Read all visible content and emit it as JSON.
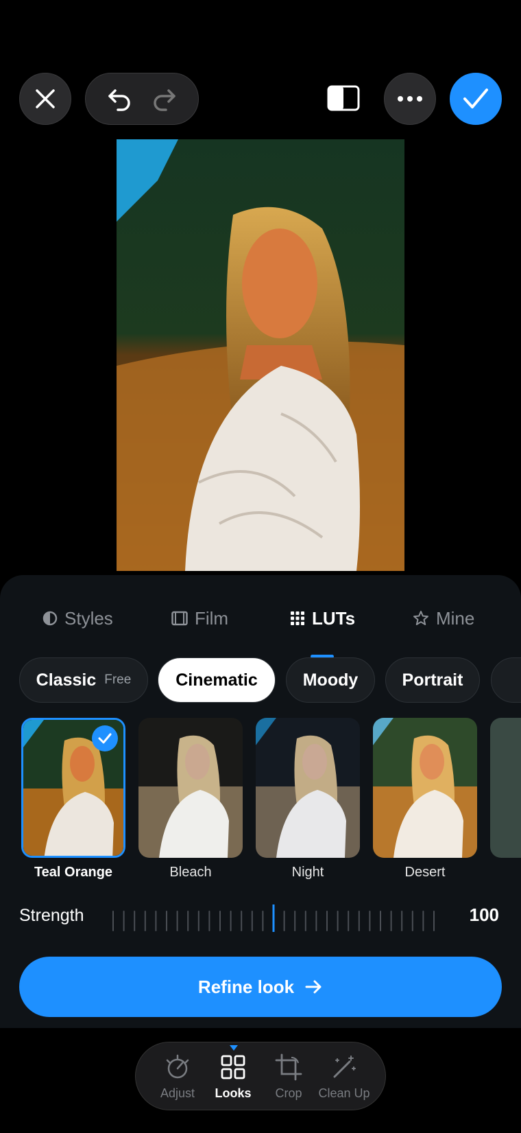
{
  "toolbar": {
    "close_icon": "close-icon",
    "undo_icon": "undo-icon",
    "redo_icon": "redo-icon",
    "compare_icon": "compare-icon",
    "more_icon": "more-icon",
    "confirm_icon": "checkmark-icon",
    "accent": "#1e90ff"
  },
  "tabs": [
    {
      "label": "Styles",
      "icon": "half-circle-icon"
    },
    {
      "label": "Film",
      "icon": "film-icon"
    },
    {
      "label": "LUTs",
      "icon": "grid-icon",
      "active": true
    },
    {
      "label": "Mine",
      "icon": "star-icon"
    }
  ],
  "chips": [
    {
      "label": "Classic",
      "sub": "Free"
    },
    {
      "label": "Cinematic",
      "active": true
    },
    {
      "label": "Moody"
    },
    {
      "label": "Portrait"
    }
  ],
  "looks": [
    {
      "label": "Teal Orange",
      "selected": true
    },
    {
      "label": "Bleach"
    },
    {
      "label": "Night"
    },
    {
      "label": "Desert"
    }
  ],
  "strength": {
    "label": "Strength",
    "value": "100"
  },
  "refine": {
    "label": "Refine look"
  },
  "nav": [
    {
      "label": "Adjust"
    },
    {
      "label": "Looks",
      "active": true
    },
    {
      "label": "Crop"
    },
    {
      "label": "Clean Up"
    }
  ]
}
